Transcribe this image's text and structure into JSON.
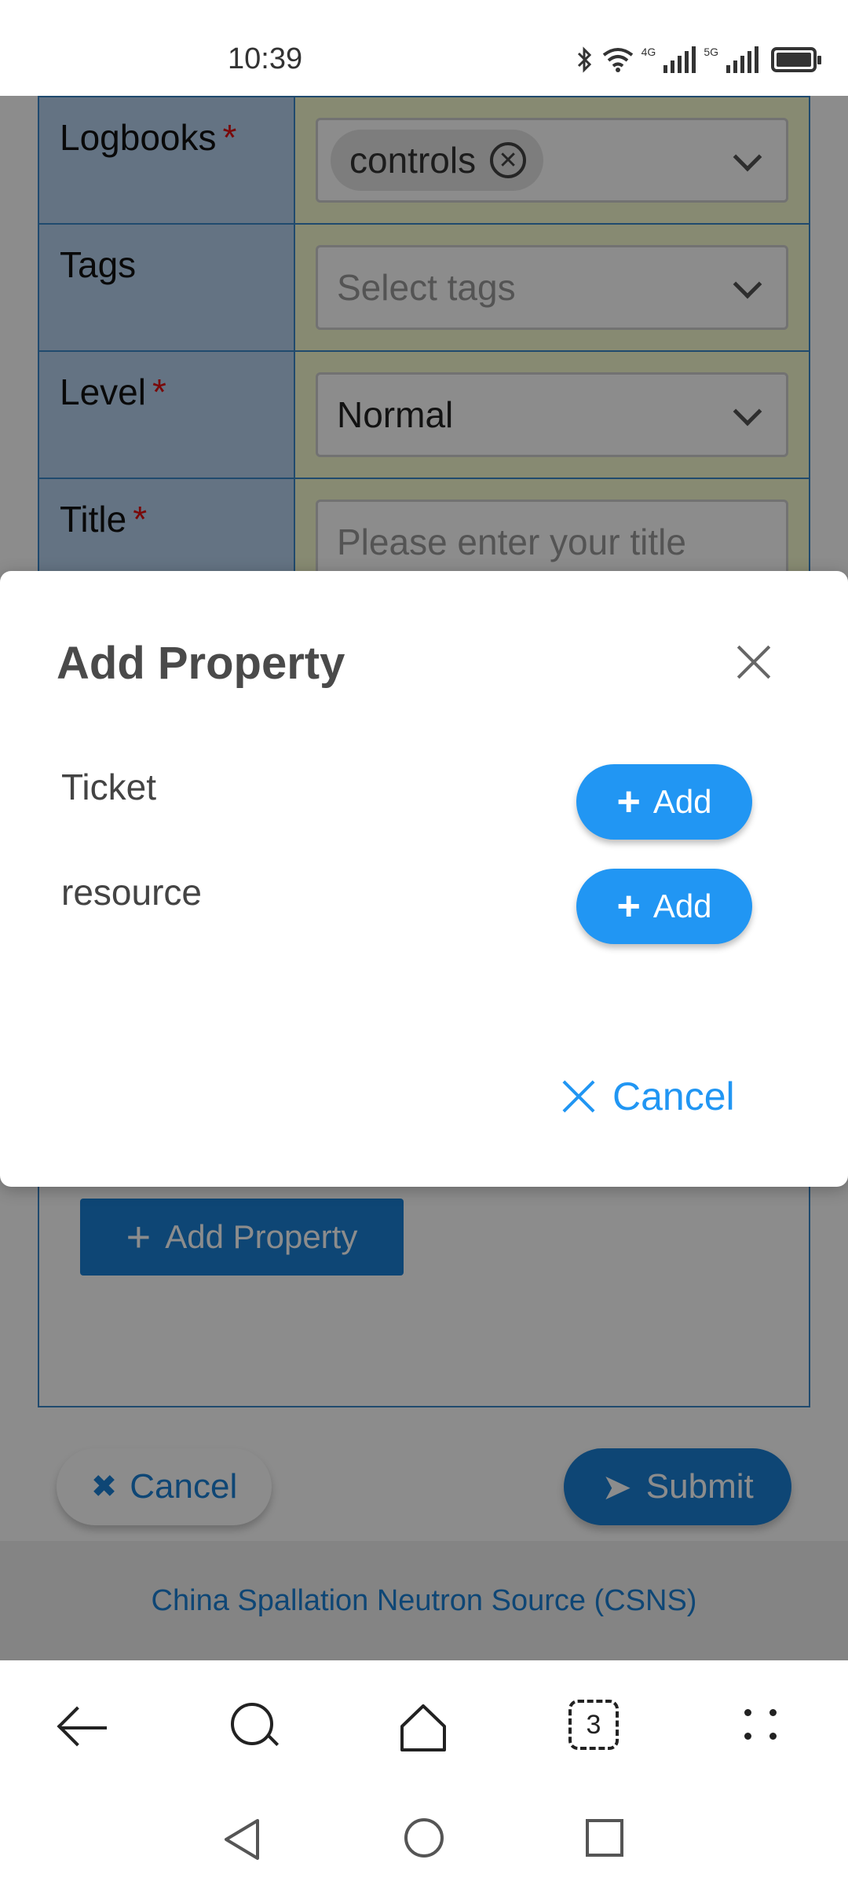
{
  "status_bar": {
    "time": "10:39",
    "net1": "4G",
    "net2": "5G"
  },
  "form": {
    "rows": [
      {
        "label": "Logbooks",
        "required": "*",
        "chip": "controls"
      },
      {
        "label": "Tags",
        "placeholder": "Select tags"
      },
      {
        "label": "Level",
        "required": "*",
        "value": "Normal"
      },
      {
        "label": "Title",
        "required": "*",
        "placeholder": "Please enter your title"
      }
    ],
    "add_property_button": "Add Property",
    "cancel_button": "Cancel",
    "submit_button": "Submit"
  },
  "footer": {
    "text": "China Spallation Neutron Source (CSNS)"
  },
  "dialog": {
    "title": "Add Property",
    "properties": [
      {
        "label": "Ticket",
        "button": "Add"
      },
      {
        "label": "resource",
        "button": "Add"
      }
    ],
    "cancel": "Cancel"
  },
  "browser_nav": {
    "tab_count": "3"
  },
  "colors": {
    "primary": "#1a80d6",
    "dialog_button": "#2196f3",
    "required": "#dd1111"
  },
  "icons": [
    "bluetooth-icon",
    "wifi-icon",
    "signal-icon",
    "battery-icon",
    "close-icon",
    "plus-icon",
    "send-icon",
    "back-arrow-icon",
    "search-icon",
    "home-icon",
    "tabs-icon",
    "menu-dots-icon"
  ]
}
